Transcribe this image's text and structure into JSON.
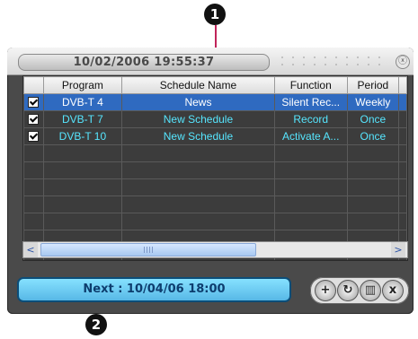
{
  "callouts": [
    "1",
    "2"
  ],
  "window": {
    "datetime": "10/02/2006 19:55:37",
    "close_label": "ⓧ"
  },
  "table": {
    "columns": [
      "",
      "Program",
      "Schedule Name",
      "Function",
      "Period"
    ],
    "rows": [
      {
        "checked": true,
        "program": "DVB-T 4",
        "name": "News",
        "function": "Silent Rec...",
        "period": "Weekly",
        "selected": true
      },
      {
        "checked": true,
        "program": "DVB-T 7",
        "name": "New Schedule",
        "function": "Record",
        "period": "Once",
        "selected": false
      },
      {
        "checked": true,
        "program": "DVB-T 10",
        "name": "New Schedule",
        "function": "Activate A...",
        "period": "Once",
        "selected": false
      }
    ]
  },
  "scroll": {
    "left": "<",
    "right": ">"
  },
  "next_text": "Next : 10/04/06 18:00",
  "buttons": [
    {
      "icon": "add-icon",
      "glyph": "+"
    },
    {
      "icon": "refresh-icon",
      "glyph": "↻"
    },
    {
      "icon": "trash-icon",
      "glyph": "▥"
    },
    {
      "icon": "delete-all-icon",
      "glyph": "x"
    }
  ],
  "colors": {
    "selected_row": "#2f6ac0",
    "normal_text": "#56e6ff",
    "next_bar": "#66c6ef",
    "callout_line": "#c0245a"
  }
}
